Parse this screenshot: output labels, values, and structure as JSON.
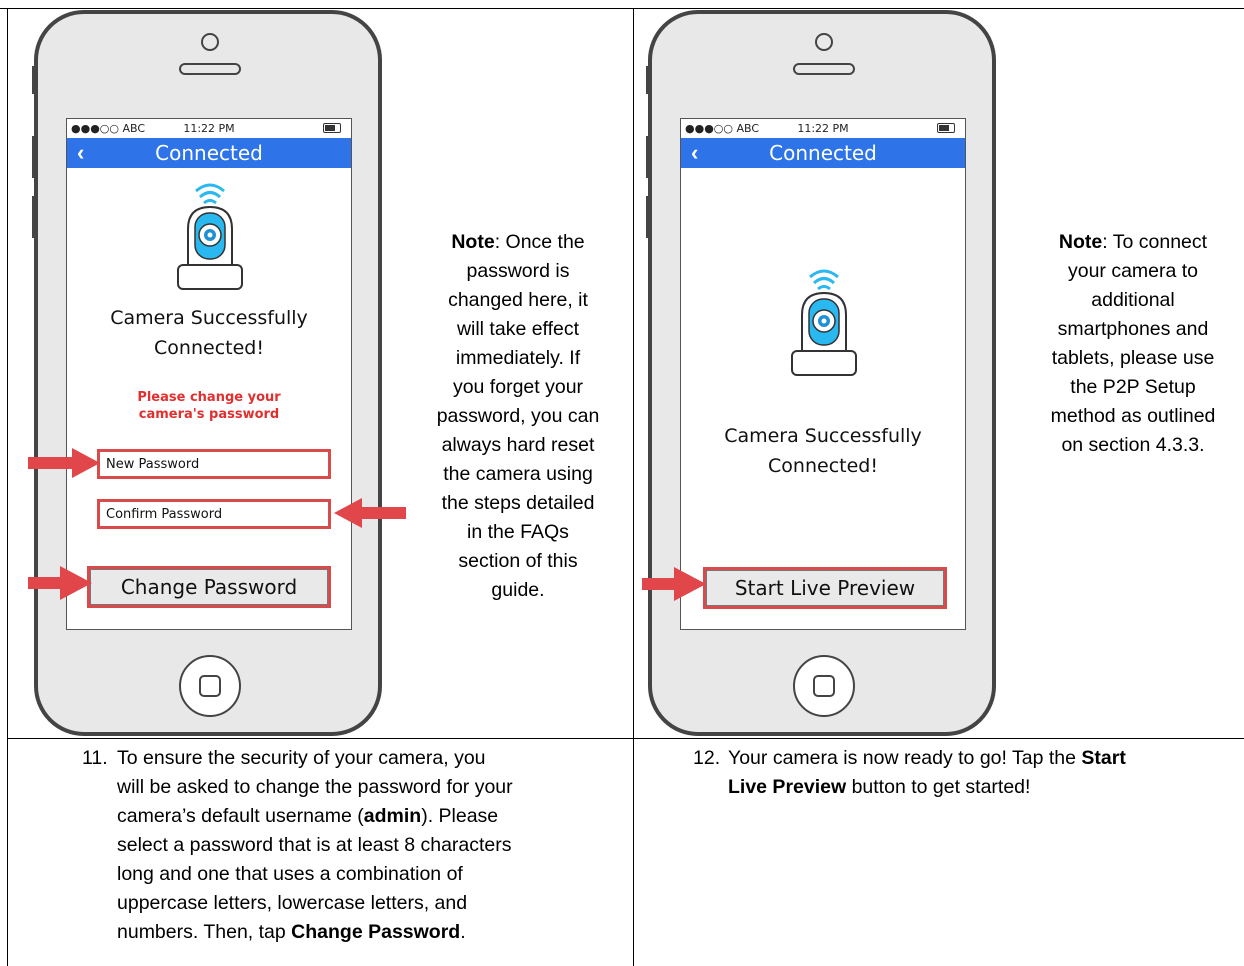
{
  "phones": {
    "left": {
      "status": {
        "carrier": "●●●○○ ABC",
        "time": "11:22 PM"
      },
      "nav": {
        "back": "‹",
        "title": "Connected"
      },
      "message_line1": "Camera Successfully",
      "message_line2": "Connected!",
      "prompt_line1": "Please change your",
      "prompt_line2": "camera's password",
      "new_password_placeholder": "New Password",
      "confirm_password_placeholder": "Confirm Password",
      "button": "Change Password"
    },
    "right": {
      "status": {
        "carrier": "●●●○○ ABC",
        "time": "11:22 PM"
      },
      "nav": {
        "back": "‹",
        "title": "Connected"
      },
      "message_line1": "Camera Successfully",
      "message_line2": "Connected!",
      "button": "Start Live Preview"
    }
  },
  "notes": {
    "left": {
      "label": "Note",
      "lines": [
        "password is",
        "changed here, it",
        "will take effect",
        "immediately. If",
        "you forget your",
        "password, you can",
        "always hard reset",
        "the camera using",
        "the steps detailed",
        "in the FAQs",
        "section of this",
        "guide."
      ],
      "first_rest": ": Once the"
    },
    "right": {
      "label": "Note",
      "first_rest": ": To connect",
      "lines": [
        "your camera to",
        "additional",
        "smartphones and",
        "tablets, please use",
        "the P2P Setup",
        "method as outlined",
        "on section 4.3.3."
      ]
    }
  },
  "steps": {
    "s11": {
      "num": "11.",
      "l1": "To ensure the security of your camera, you",
      "l2": "will be asked to change the password for your",
      "l3a": "camera’s default username (",
      "l3b": "admin",
      "l3c": "). Please",
      "l4": "select a password that is at least 8 characters",
      "l5": "long and one that uses a combination of",
      "l6": "uppercase letters, lowercase letters, and",
      "l7a": "numbers. Then, tap ",
      "l7b": "Change Password",
      "l7c": "."
    },
    "s12": {
      "num": "12.",
      "l1a": "Your camera is now ready to go! Tap the ",
      "l1b": "Start",
      "l2a": "Live Preview",
      "l2b": " button to get started!"
    }
  },
  "colors": {
    "accent": "#2e74e8",
    "highlight": "#d94b4b",
    "arrow": "#e0464a",
    "wifi": "#29b8f0"
  }
}
